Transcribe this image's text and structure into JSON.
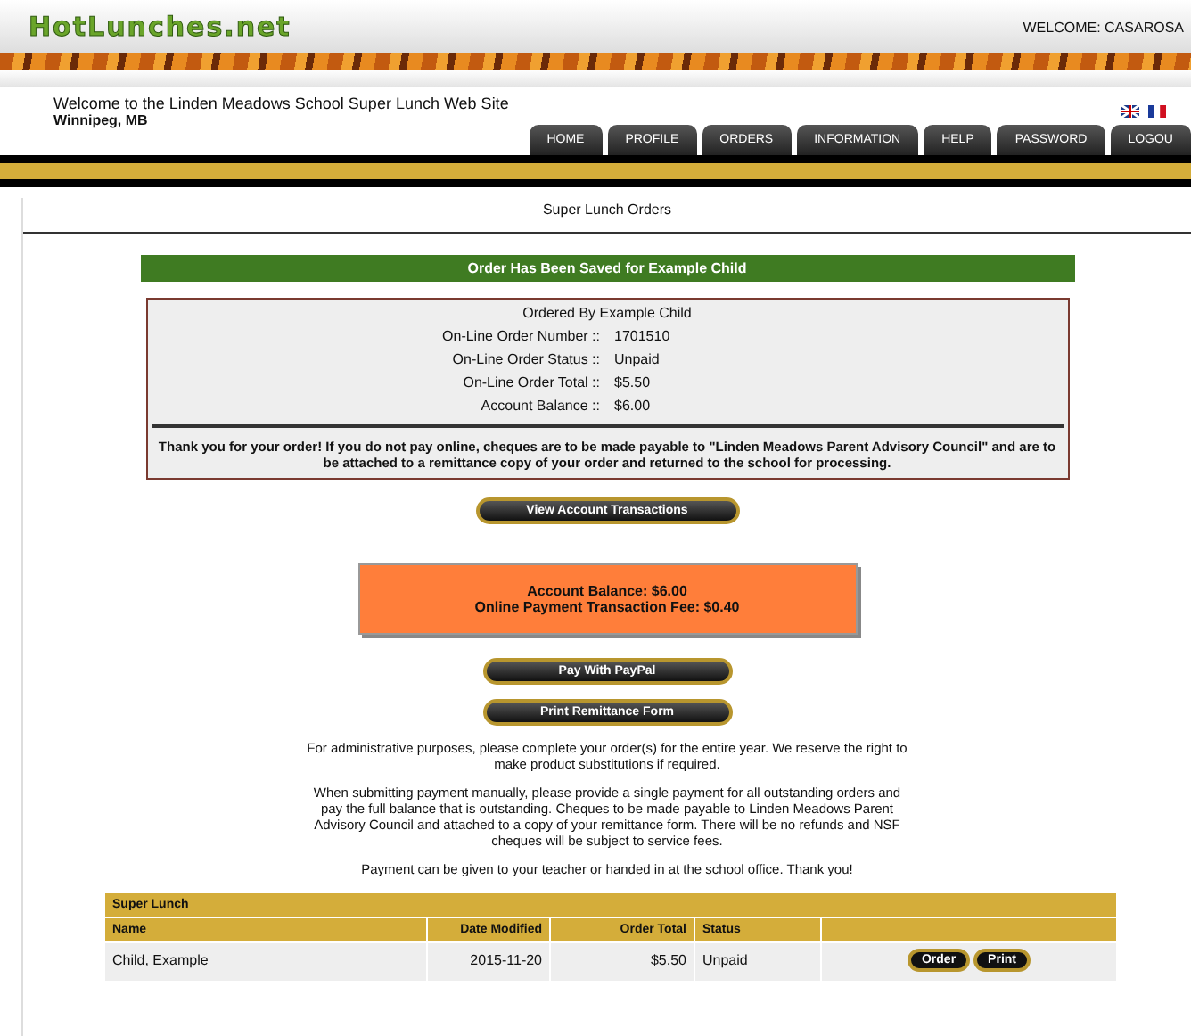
{
  "header": {
    "logo": "HotLunches.net",
    "welcome": "WELCOME: CASAROSA"
  },
  "site": {
    "title": "Welcome to the Linden Meadows School Super Lunch Web Site",
    "location": "Winnipeg, MB"
  },
  "tabs": [
    {
      "label": "HOME"
    },
    {
      "label": "PROFILE"
    },
    {
      "label": "ORDERS"
    },
    {
      "label": "INFORMATION"
    },
    {
      "label": "HELP"
    },
    {
      "label": "PASSWORD"
    },
    {
      "label": "LOGOU"
    }
  ],
  "page_title": "Super Lunch Orders",
  "notice": "Order Has Been Saved for Example Child",
  "summary": {
    "ordered_by": "Ordered By Example Child",
    "rows": [
      {
        "label": "On-Line Order Number ::",
        "value": "1701510"
      },
      {
        "label": "On-Line Order Status ::",
        "value": "Unpaid"
      },
      {
        "label": "On-Line Order Total ::",
        "value": "$5.50"
      },
      {
        "label": "Account Balance ::",
        "value": "$6.00"
      }
    ],
    "message": "Thank you for your order! If you do not pay online, cheques are to be made payable to \"Linden Meadows Parent Advisory Council\" and are to be attached to a remittance copy of your order and returned to the school for processing."
  },
  "view_button": "View Account Transactions",
  "balance_box": [
    "Account Balance: $6.00",
    "Online Payment Transaction Fee: $0.40"
  ],
  "pay_buttons": [
    "Pay With PayPal",
    "Print Remittance Form"
  ],
  "paragraphs": [
    "For administrative purposes, please complete your order(s) for the entire year. We reserve the right to make product substitutions if required.",
    "When submitting payment manually, please provide a single payment for all outstanding orders and pay the full balance that is outstanding. Cheques to be made payable to Linden Meadows Parent Advisory Council and attached to a copy of your remittance form. There will be no refunds and NSF cheques will be subject to service fees.",
    "Payment can be given to your teacher or handed in at the school office. Thank you!"
  ],
  "table": {
    "title": "Super Lunch",
    "columns": [
      "Name",
      "Date Modified",
      "Order Total",
      "Status"
    ],
    "rows": [
      {
        "name": "Child, Example",
        "date": "2015-11-20",
        "total": "$5.50",
        "status": "Unpaid",
        "actions": [
          "Order",
          "Print"
        ]
      }
    ]
  }
}
